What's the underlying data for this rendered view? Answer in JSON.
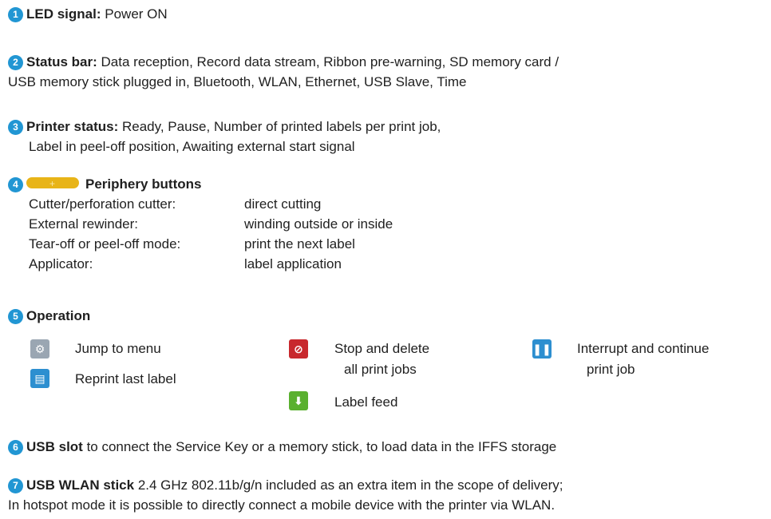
{
  "items": {
    "1": {
      "num": "1",
      "title": "LED signal:",
      "text": "Power ON"
    },
    "2": {
      "num": "2",
      "title": "Status bar:",
      "text1": "Data reception, Record data stream, Ribbon pre-warning, SD memory card /",
      "text2": "USB memory stick plugged in, Bluetooth, WLAN, Ethernet, USB Slave, Time"
    },
    "3": {
      "num": "3",
      "title": "Printer status:",
      "text1": "Ready, Pause, Number of printed labels per print job,",
      "text2": "Label in peel-off position, Awaiting external start signal"
    },
    "4": {
      "num": "4",
      "title": "Periphery buttons",
      "rows": [
        {
          "k": "Cutter/perforation cutter:",
          "v": "direct cutting"
        },
        {
          "k": "External rewinder:",
          "v": "winding outside or inside"
        },
        {
          "k": "Tear-off or peel-off mode:",
          "v": "print the next label"
        },
        {
          "k": "Applicator:",
          "v": "label application"
        }
      ]
    },
    "5": {
      "num": "5",
      "title": "Operation",
      "menu": "Jump to menu",
      "reprint": "Reprint last label",
      "stop1": "Stop and delete",
      "stop2": "all print jobs",
      "feed": "Label feed",
      "pause1": "Interrupt and continue",
      "pause2": "print job"
    },
    "6": {
      "num": "6",
      "title": "USB slot",
      "text": "to connect the Service Key or a memory stick, to load data in the IFFS storage"
    },
    "7": {
      "num": "7",
      "title": "USB WLAN stick",
      "text1": "2.4 GHz 802.11b/g/n included as an extra item in the scope of delivery;",
      "text2": "In hotspot mode it is possible to directly connect a mobile device with the printer via WLAN."
    }
  },
  "colors": {
    "badge": "#2196d3",
    "periphery": "#e8b418",
    "menu": "#9aa6b2",
    "reprint": "#2d8fd0",
    "stop": "#c8282d",
    "feed": "#5ab02f",
    "pause": "#2d8fd0"
  },
  "icons": {
    "menu": "gear-icon",
    "reprint": "printer-icon",
    "stop": "stop-icon",
    "feed": "arrow-down-icon",
    "pause": "pause-icon"
  }
}
